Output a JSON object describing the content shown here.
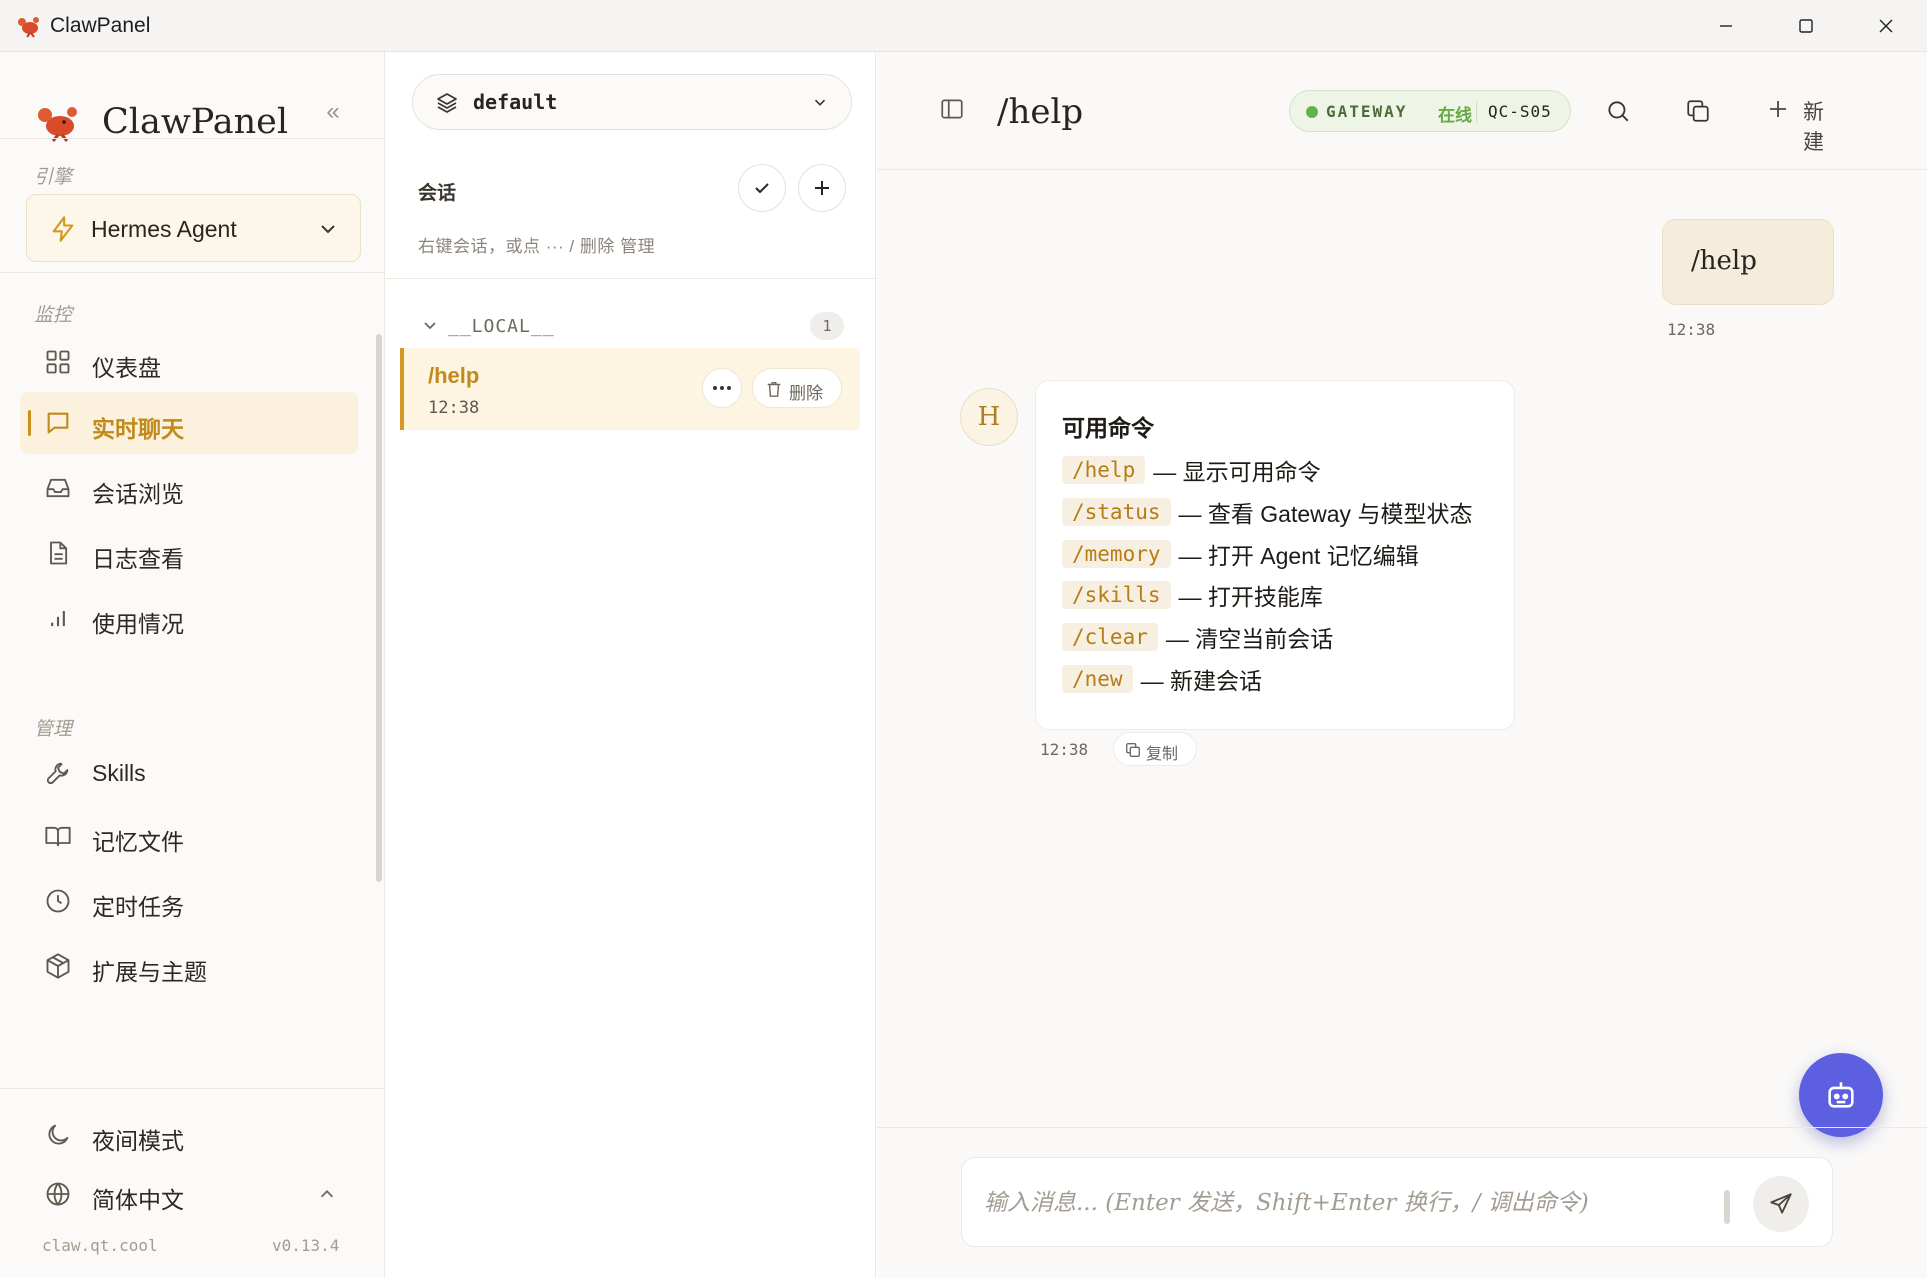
{
  "window": {
    "title": "ClawPanel",
    "controls": [
      "minimize-icon",
      "maximize-icon",
      "close-icon"
    ]
  },
  "sidebar": {
    "brand": "ClawPanel",
    "collapse_glyph": "«",
    "engine_section": "引擎",
    "engine": "Hermes Agent",
    "monitor_section": "监控",
    "monitor_items": [
      {
        "label": "仪表盘",
        "icon": "grid-icon"
      },
      {
        "label": "实时聊天",
        "icon": "chat-icon",
        "active": true
      },
      {
        "label": "会话浏览",
        "icon": "inbox-icon"
      },
      {
        "label": "日志查看",
        "icon": "file-icon"
      },
      {
        "label": "使用情况",
        "icon": "bar-chart-icon"
      }
    ],
    "manage_section": "管理",
    "manage_items": [
      {
        "label": "Skills",
        "icon": "wrench-icon"
      },
      {
        "label": "记忆文件",
        "icon": "book-icon"
      },
      {
        "label": "定时任务",
        "icon": "clock-icon"
      },
      {
        "label": "扩展与主题",
        "icon": "package-icon"
      }
    ],
    "night_mode": "夜间模式",
    "language": "简体中文",
    "site": "claw.qt.cool",
    "version": "v0.13.4"
  },
  "sessions": {
    "agent": "default",
    "title": "会话",
    "hint": "右键会话，或点 ··· / 删除 管理",
    "group": {
      "name": "__LOCAL__",
      "count": "1"
    },
    "items": [
      {
        "title": "/help",
        "time": "12:38",
        "delete_label": "删除"
      }
    ]
  },
  "chat": {
    "title": "/help",
    "gateway": {
      "label": "GATEWAY",
      "status": "在线",
      "host": "QC-S05",
      "status_color": "#66b04a"
    },
    "new_label": "新建",
    "user_message": {
      "text": "/help",
      "time": "12:38"
    },
    "bot_avatar": "H",
    "bot_message": {
      "heading": "可用命令",
      "commands": [
        {
          "cmd": "/help",
          "desc": "— 显示可用命令"
        },
        {
          "cmd": "/status",
          "desc": "— 查看 Gateway 与模型状态"
        },
        {
          "cmd": "/memory",
          "desc": "— 打开 Agent 记忆编辑"
        },
        {
          "cmd": "/skills",
          "desc": "— 打开技能库"
        },
        {
          "cmd": "/clear",
          "desc": "— 清空当前会话"
        },
        {
          "cmd": "/new",
          "desc": "— 新建会话"
        }
      ],
      "time": "12:38",
      "copy_label": "复制"
    },
    "composer": {
      "value": "",
      "placeholder": "输入消息... (Enter 发送，Shift+Enter 换行，/ 调出命令)"
    },
    "accent_color": "#5b5fe0"
  }
}
